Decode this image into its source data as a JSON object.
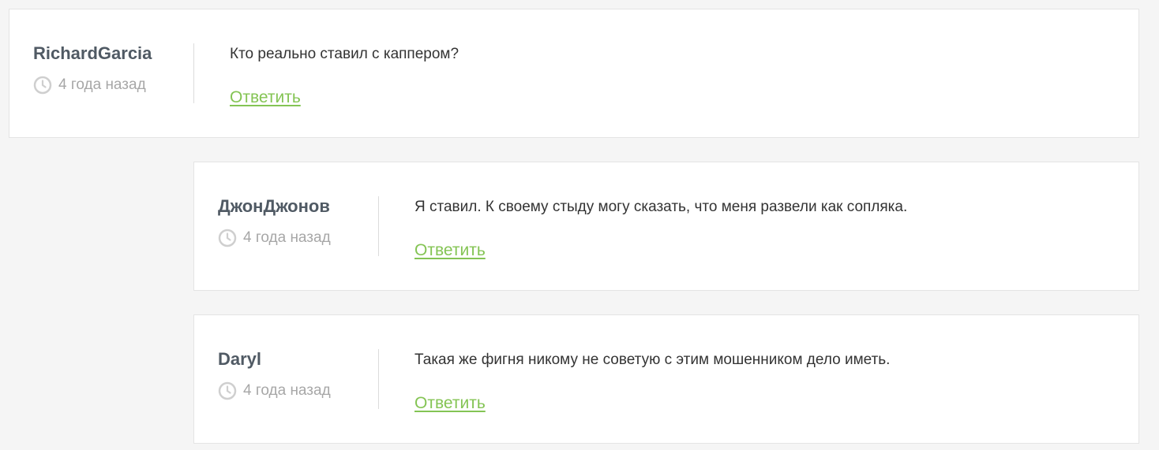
{
  "comments": [
    {
      "author": "RichardGarcia",
      "time": "4 года назад",
      "text": "Кто реально ставил с каппером?",
      "reply_label": "Ответить"
    },
    {
      "author": "ДжонДжонов",
      "time": "4 года назад",
      "text": "Я ставил. К своему стыду могу сказать, что меня развели как сопляка.",
      "reply_label": "Ответить"
    },
    {
      "author": "Daryl",
      "time": "4 года назад",
      "text": "Такая же фигня никому не советую с этим мошенником дело иметь.",
      "reply_label": "Ответить"
    }
  ],
  "colors": {
    "background": "#f5f5f5",
    "card": "#ffffff",
    "author": "#505a64",
    "muted": "#a7a7a7",
    "link": "#84c454"
  },
  "icons": [
    "clock-icon"
  ]
}
